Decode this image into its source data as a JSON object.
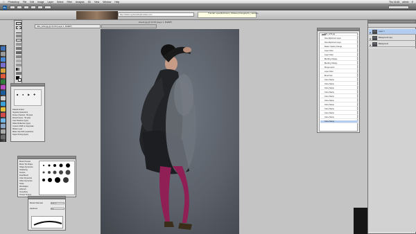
{
  "menubar": {
    "items": [
      "Photoshop",
      "File",
      "Edit",
      "Image",
      "Layer",
      "Select",
      "Filter",
      "Analysis",
      "3D",
      "View",
      "Window",
      "Help"
    ],
    "clock": "Thu 16:46",
    "user": "admin"
  },
  "browser": {
    "url": "http://www.myphotoshopbrushes.com",
    "window_title": "Tutorial: specificphotos | Ottawa photography | sketchy"
  },
  "document": {
    "tab_title": "IMG_1234.jpg @ 33.3% (Layer 1, RGB/8*)",
    "title": "sheet1.jpg @ 33.3% (Layer 1, RGB/8*)"
  },
  "history": {
    "snapshot": "IMG_1234.jpg",
    "items": [
      "New Adjustment Layer",
      "New Adjustment Layer",
      "Master Opacity Change",
      "Layer Order",
      "Layer Order",
      "Blending Change",
      "Blending Change",
      "Merge Layers",
      "Layer Order",
      "Brush Tool",
      "Clone Stamp",
      "Clone Stamp",
      "Clone Stamp",
      "Clone Stamp",
      "Clone Stamp",
      "Clone Stamp",
      "Clone Stamp",
      "Clone Stamp",
      "Clone Stamp",
      "Clone Stamp",
      "Clone Stamp"
    ],
    "selected_index": 20
  },
  "layers": {
    "items": [
      {
        "name": "Layer 1",
        "selected": true
      },
      {
        "name": "Background copy",
        "selected": false
      },
      {
        "name": "Background",
        "selected": false
      }
    ]
  },
  "actions": {
    "rows": [
      "Default Actions",
      "Vignette (selection)",
      "Frame Channel - 50 pixel",
      "Wood Frame - 50 pixel",
      "Cast Shadow (type)",
      "Water Reflection (type)",
      "Custom RGB to Grayscale",
      "Molten Lead",
      "Make Clip Path (selection)",
      "Sepia Toning (layer)"
    ]
  },
  "presets": {
    "rows": [
      "Brush Presets",
      "Brush Tip Shape",
      "Shape Dynamics",
      "Scattering",
      "Texture",
      "Dual Brush",
      "Color Dynamics",
      "Other Dynamics",
      "Noise",
      "Wet Edges",
      "Airbrush",
      "Smoothing",
      "Protect Texture"
    ]
  },
  "brush_tool": {
    "rows": [
      "Master Diameter",
      "Hardness"
    ],
    "values": [
      "100 px",
      "0%"
    ]
  },
  "colors": {
    "selection": "#b3cdf0",
    "canvas_bg": "#5b6069",
    "stockings": "#8f1f55"
  }
}
